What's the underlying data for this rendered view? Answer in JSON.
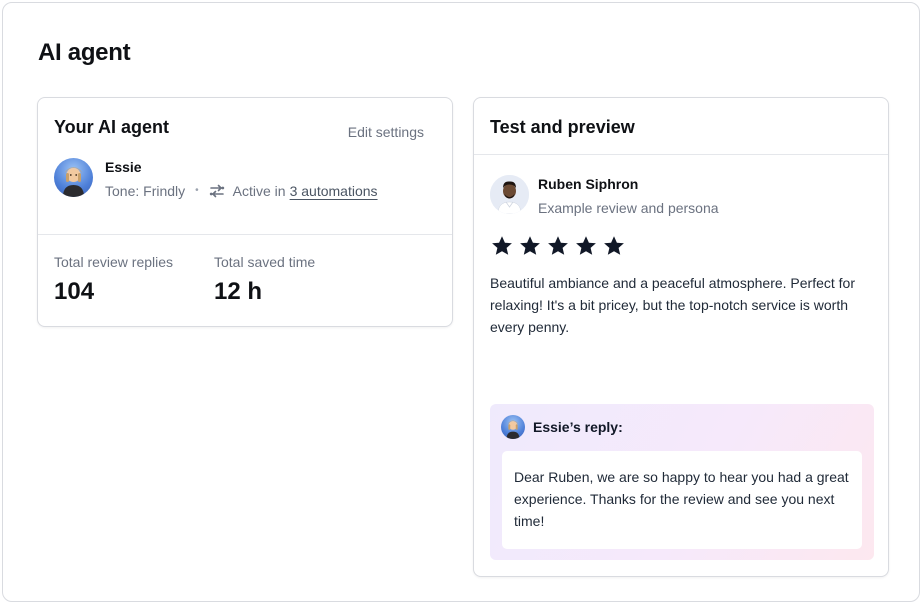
{
  "page": {
    "title": "AI agent"
  },
  "agent_card": {
    "title": "Your AI agent",
    "edit_label": "Edit settings",
    "agent": {
      "name": "Essie",
      "tone": "Tone: Frindly",
      "separator": "•",
      "active_prefix": "Active in",
      "automations_link": "3 automations"
    },
    "stats": [
      {
        "label": "Total review replies",
        "value": "104"
      },
      {
        "label": "Total saved time",
        "value": "12 h"
      }
    ]
  },
  "preview_card": {
    "title": "Test and preview",
    "reviewer": {
      "name": "Ruben Siphron",
      "subtitle": "Example review and persona"
    },
    "rating": {
      "stars": 5,
      "max": 5
    },
    "review_text": "Beautiful ambiance and a peaceful atmosphere. Perfect for relaxing! It's a bit pricey, but the top-notch service is worth every penny.",
    "reply": {
      "label": "Essie’s reply:",
      "text": "Dear Ruben, we are so happy to hear you had a great experience. Thanks for the review and see you next time!"
    }
  },
  "icons": {
    "automation": "automation-arrows-icon",
    "star": "star-icon",
    "essie_avatar": "avatar-essie",
    "ruben_avatar": "avatar-ruben"
  },
  "colors": {
    "text_primary": "#0f1115",
    "text_secondary": "#6b7280",
    "border": "#d9dbe0",
    "reply_gradient_start": "#efeafc",
    "reply_gradient_end": "#fde8ef",
    "star": "#111827"
  }
}
